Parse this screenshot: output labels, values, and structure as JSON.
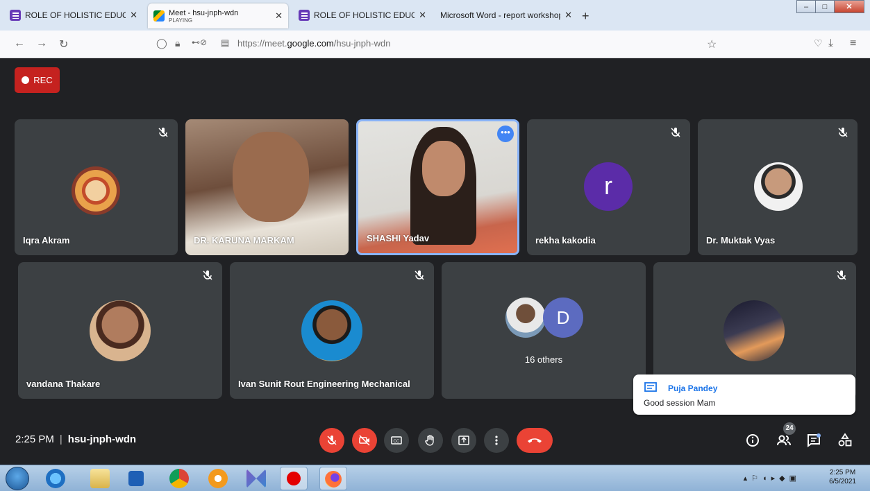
{
  "browser": {
    "tabs": [
      {
        "title": "ROLE OF HOLISTIC EDUCATION",
        "icon": "google-forms-icon"
      },
      {
        "title": "Meet - hsu-jnph-wdn",
        "subtitle": "PLAYING",
        "icon": "google-meet-icon"
      },
      {
        "title": "ROLE OF HOLISTIC EDUCATION",
        "icon": "google-forms-icon"
      },
      {
        "title": "Microsoft Word - report workshop_",
        "icon": "none"
      }
    ],
    "url_prefix": "https://meet.",
    "url_domain": "google.com",
    "url_path": "/hsu-jnph-wdn"
  },
  "meet": {
    "rec_label": "REC",
    "participants": [
      {
        "name": "Iqra Akram"
      },
      {
        "name": "DR. KARUNA MARKAM"
      },
      {
        "name": "SHASHI Yadav"
      },
      {
        "name": "rekha kakodia",
        "initial": "r"
      },
      {
        "name": "Dr. Muktak Vyas"
      },
      {
        "name": "vandana Thakare"
      },
      {
        "name": "Ivan Sunit Rout Engineering Mechanical"
      },
      {
        "name": "16 others",
        "initial": "D"
      }
    ],
    "toast": {
      "sender": "Puja Pandey",
      "message": "Good session Mam"
    },
    "time": "2:25 PM",
    "meeting_code": "hsu-jnph-wdn",
    "people_count": "24"
  },
  "taskbar": {
    "time": "2:25 PM",
    "date": "6/5/2021"
  },
  "colors": {
    "meet_bg": "#202124",
    "tile_bg": "#3c4043",
    "red": "#ea4335",
    "accent": "#1a73e8"
  }
}
